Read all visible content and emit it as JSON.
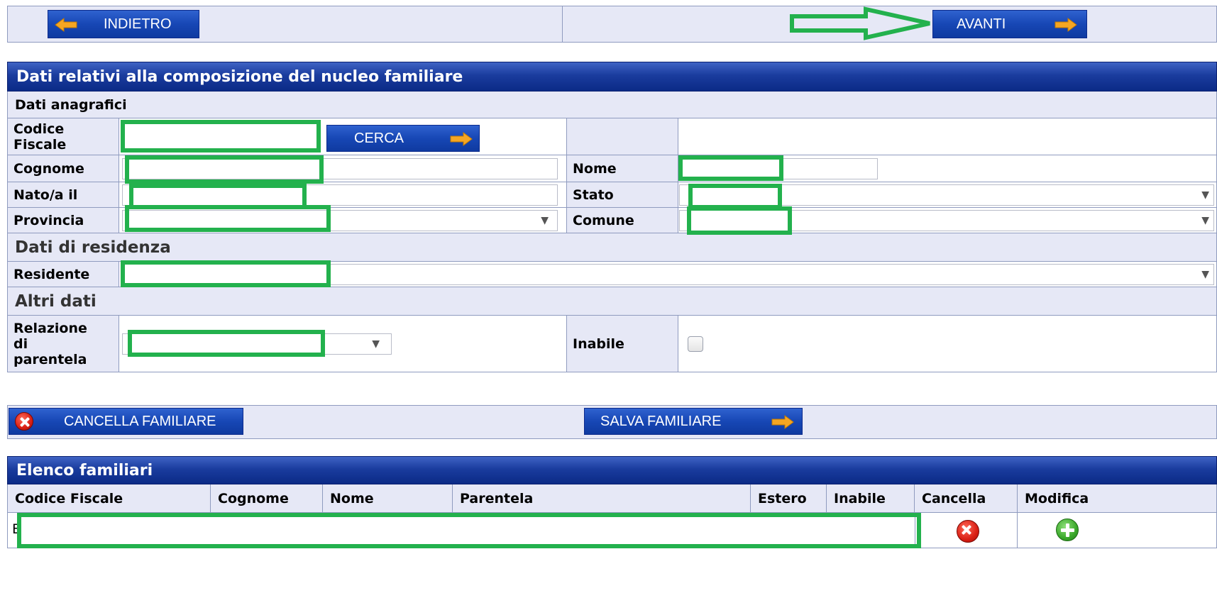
{
  "nav": {
    "back_label": "INDIETRO",
    "next_label": "AVANTI"
  },
  "section_nucleo": {
    "title": "Dati relativi alla composizione del nucleo familiare",
    "anagrafici_header": "Dati anagrafici",
    "codice_fiscale_label": "Codice Fiscale",
    "cerca_label": "CERCA",
    "cognome_label": "Cognome",
    "nome_label": "Nome",
    "nato_label": "Nato/a il",
    "stato_label": "Stato",
    "provincia_label": "Provincia",
    "comune_label": "Comune",
    "residenza_header": "Dati di residenza",
    "residente_label": "Residente",
    "altri_header": "Altri dati",
    "relazione_label": "Relazione di parentela",
    "inabile_label": "Inabile"
  },
  "actions": {
    "cancella_label": "CANCELLA FAMILIARE",
    "salva_label": "SALVA FAMILIARE"
  },
  "elenco": {
    "title": "Elenco familiari",
    "columns": [
      "Codice Fiscale",
      "Cognome",
      "Nome",
      "Parentela",
      "Estero",
      "Inabile",
      "Cancella",
      "Modifica"
    ],
    "row_prefix": "E"
  },
  "colors": {
    "header_blue": "#1a3c9e",
    "label_bg": "#e6e8f6",
    "highlight_green": "#23b14d",
    "arrow_orange": "#f5a623"
  },
  "icons": {
    "back": "arrow-left-icon",
    "next": "arrow-right-icon",
    "delete": "x-circle-icon",
    "edit": "plus-circle-icon"
  }
}
